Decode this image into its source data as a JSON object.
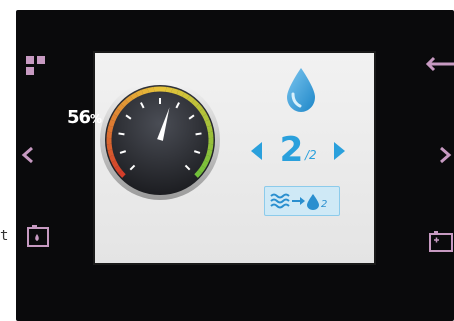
{
  "side_label": "t",
  "gauge": {
    "percent": 56,
    "value_label": "56",
    "unit_label": "%"
  },
  "level": {
    "current": "2",
    "total": "/2"
  },
  "mode": {
    "sub_label": "2"
  },
  "icons": {
    "top_left": "menu-grid-icon",
    "left_mid": "chevron-left-icon",
    "bottom_left": "battery-water-icon",
    "top_right": "back-arrow-icon",
    "right_mid": "chevron-right-icon",
    "bottom_right": "battery-plus-icon",
    "water": "water-drop-icon",
    "mode": "water-waves-to-oxygen-icon"
  },
  "colors": {
    "accent": "#2aa0dc",
    "button_pink": "#c79ac2",
    "gauge_green": "#6fbf3a",
    "gauge_yellow": "#e9c43a",
    "gauge_red": "#d23a2a"
  }
}
